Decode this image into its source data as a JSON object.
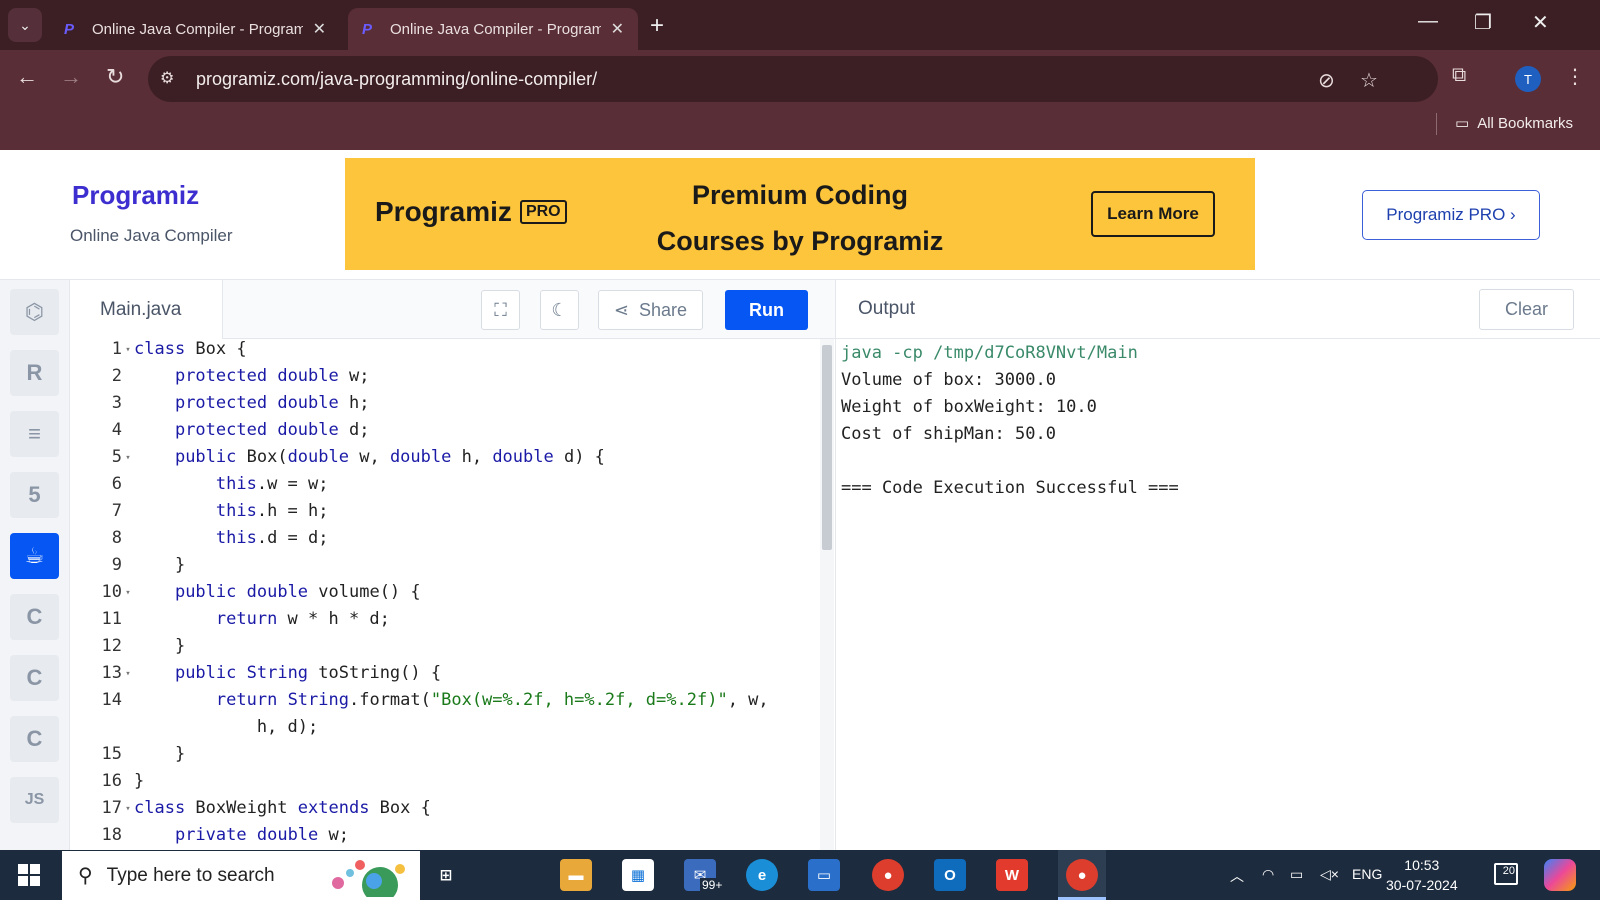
{
  "browser": {
    "tabs": [
      {
        "title": "Online Java Compiler - Program",
        "active": false
      },
      {
        "title": "Online Java Compiler - Program",
        "active": true
      }
    ],
    "url": "programiz.com/java-programming/online-compiler/",
    "bookmarks_label": "All Bookmarks",
    "profile_initial": "T"
  },
  "header": {
    "logo": "Programiz",
    "subtitle": "Online Java Compiler",
    "banner": {
      "logo": "Programiz",
      "logo_badge": "PRO",
      "line1": "Premium Coding",
      "line2": "Courses by Programiz",
      "button": "Learn More"
    },
    "pro_button": "Programiz PRO ›"
  },
  "sidebar": {
    "languages": [
      {
        "icon": "python-icon",
        "label": "",
        "active": false
      },
      {
        "icon": "r-icon",
        "label": "R",
        "active": false
      },
      {
        "icon": "sql-icon",
        "label": "",
        "active": false
      },
      {
        "icon": "html-icon",
        "label": "5",
        "active": false
      },
      {
        "icon": "java-icon",
        "label": "",
        "active": true
      },
      {
        "icon": "c-icon",
        "label": "C",
        "active": false
      },
      {
        "icon": "cpp-icon",
        "label": "C",
        "active": false
      },
      {
        "icon": "csharp-icon",
        "label": "C",
        "active": false
      },
      {
        "icon": "js-icon",
        "label": "JS",
        "active": false
      }
    ]
  },
  "editor": {
    "filename": "Main.java",
    "share_label": "Share",
    "run_label": "Run",
    "lines": [
      {
        "n": "1",
        "fold": true,
        "code": "class Box {"
      },
      {
        "n": "2",
        "fold": false,
        "code": "    protected double w;"
      },
      {
        "n": "3",
        "fold": false,
        "code": "    protected double h;"
      },
      {
        "n": "4",
        "fold": false,
        "code": "    protected double d;"
      },
      {
        "n": "5",
        "fold": true,
        "code": "    public Box(double w, double h, double d) {"
      },
      {
        "n": "6",
        "fold": false,
        "code": "        this.w = w;"
      },
      {
        "n": "7",
        "fold": false,
        "code": "        this.h = h;"
      },
      {
        "n": "8",
        "fold": false,
        "code": "        this.d = d;"
      },
      {
        "n": "9",
        "fold": false,
        "code": "    }"
      },
      {
        "n": "10",
        "fold": true,
        "code": "    public double volume() {"
      },
      {
        "n": "11",
        "fold": false,
        "code": "        return w * h * d;"
      },
      {
        "n": "12",
        "fold": false,
        "code": "    }"
      },
      {
        "n": "13",
        "fold": true,
        "code": "    public String toString() {"
      },
      {
        "n": "14",
        "fold": false,
        "code": "        return String.format(\"Box(w=%.2f, h=%.2f, d=%.2f)\", w,"
      },
      {
        "n": "",
        "fold": false,
        "code": "            h, d);"
      },
      {
        "n": "15",
        "fold": false,
        "code": "    }"
      },
      {
        "n": "16",
        "fold": false,
        "code": "}"
      },
      {
        "n": "17",
        "fold": true,
        "code": "class BoxWeight extends Box {"
      },
      {
        "n": "18",
        "fold": false,
        "code": "    private double w;"
      }
    ]
  },
  "output": {
    "title": "Output",
    "clear_label": "Clear",
    "lines": [
      "java -cp /tmp/d7CoR8VNvt/Main",
      "Volume of box: 3000.0",
      "Weight of boxWeight: 10.0",
      "Cost of shipMan: 50.0",
      "",
      "=== Code Execution Successful ==="
    ]
  },
  "taskbar": {
    "search_placeholder": "Type here to search",
    "mail_badge": "99+",
    "language": "ENG",
    "time": "10:53",
    "date": "30-07-2024",
    "notifications": "20"
  },
  "colors": {
    "accent": "#0556f3",
    "banner": "#fdc53b",
    "browser_frame": "#5a2e36"
  }
}
